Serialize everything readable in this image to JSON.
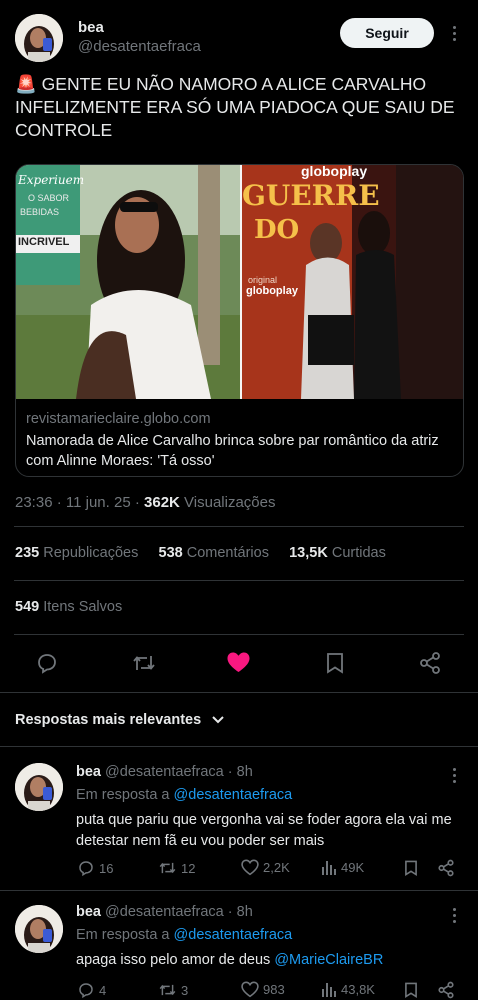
{
  "post": {
    "author_name": "bea",
    "author_handle": "@desatentaefraca",
    "follow_label": "Seguir",
    "text_emoji": "🚨",
    "text_line1": "GENTE EU NÃO NAMORO A ALICE CARVALHO",
    "text_line2": "INFELIZMENTE ERA SÓ UMA PIADOCA QUE SAIU DE",
    "text_line3": "CONTROLE",
    "link_card": {
      "domain": "revistamarieclaire.globo.com",
      "title_line1": "Namorada de Alice Carvalho brinca sobre par romântico da atriz",
      "title_line2": "com Alinne Moraes: 'Tá osso'",
      "image_left_sign_1": "Experiuem",
      "image_left_sign_2": "O SABOR",
      "image_left_sign_3": "BEBIDAS",
      "image_left_sign_4": "INCRIVEL",
      "image_right_sign_1": "globoplay",
      "image_right_sign_2": "GUERRE",
      "image_right_sign_3": "DO",
      "image_right_sign_4": "original",
      "image_right_sign_5": "globoplay"
    },
    "time": "23:36",
    "date": "11 jun. 25",
    "views_count": "362K",
    "views_label": "Visualizações",
    "reposts_count": "235",
    "reposts_label": "Republicações",
    "comments_count": "538",
    "comments_label": "Comentários",
    "likes_count": "13,5K",
    "likes_label": "Curtidas",
    "saved_count": "549",
    "saved_label": "Itens Salvos",
    "liked": true,
    "like_color": "#f91880"
  },
  "replies_header": {
    "label": "Respostas mais relevantes"
  },
  "replies": [
    {
      "author_name": "bea",
      "author_handle": "@desatentaefraca",
      "time": "8h",
      "reply_to_prefix": "Em resposta a",
      "reply_to_handle": "@desatentaefraca",
      "text_line1": "puta que pariu que vergonha vai se foder agora ela vai me",
      "text_line2": "detestar nem fã eu vou poder ser mais",
      "text_mention": "",
      "comments": "16",
      "reposts": "12",
      "likes": "2,2K",
      "views": "49K"
    },
    {
      "author_name": "bea",
      "author_handle": "@desatentaefraca",
      "time": "8h",
      "reply_to_prefix": "Em resposta a",
      "reply_to_handle": "@desatentaefraca",
      "text_line1": "apaga isso pelo amor de deus",
      "text_line2": "",
      "text_mention": "@MarieClaireBR",
      "comments": "4",
      "reposts": "3",
      "likes": "983",
      "views": "43,8K"
    }
  ],
  "icons": {
    "comment": "comment-icon",
    "repost": "repost-icon",
    "like": "heart-icon",
    "bookmark": "bookmark-icon",
    "share": "share-icon",
    "views": "views-icon",
    "more": "more-icon",
    "chevron": "chevron-down-icon"
  }
}
